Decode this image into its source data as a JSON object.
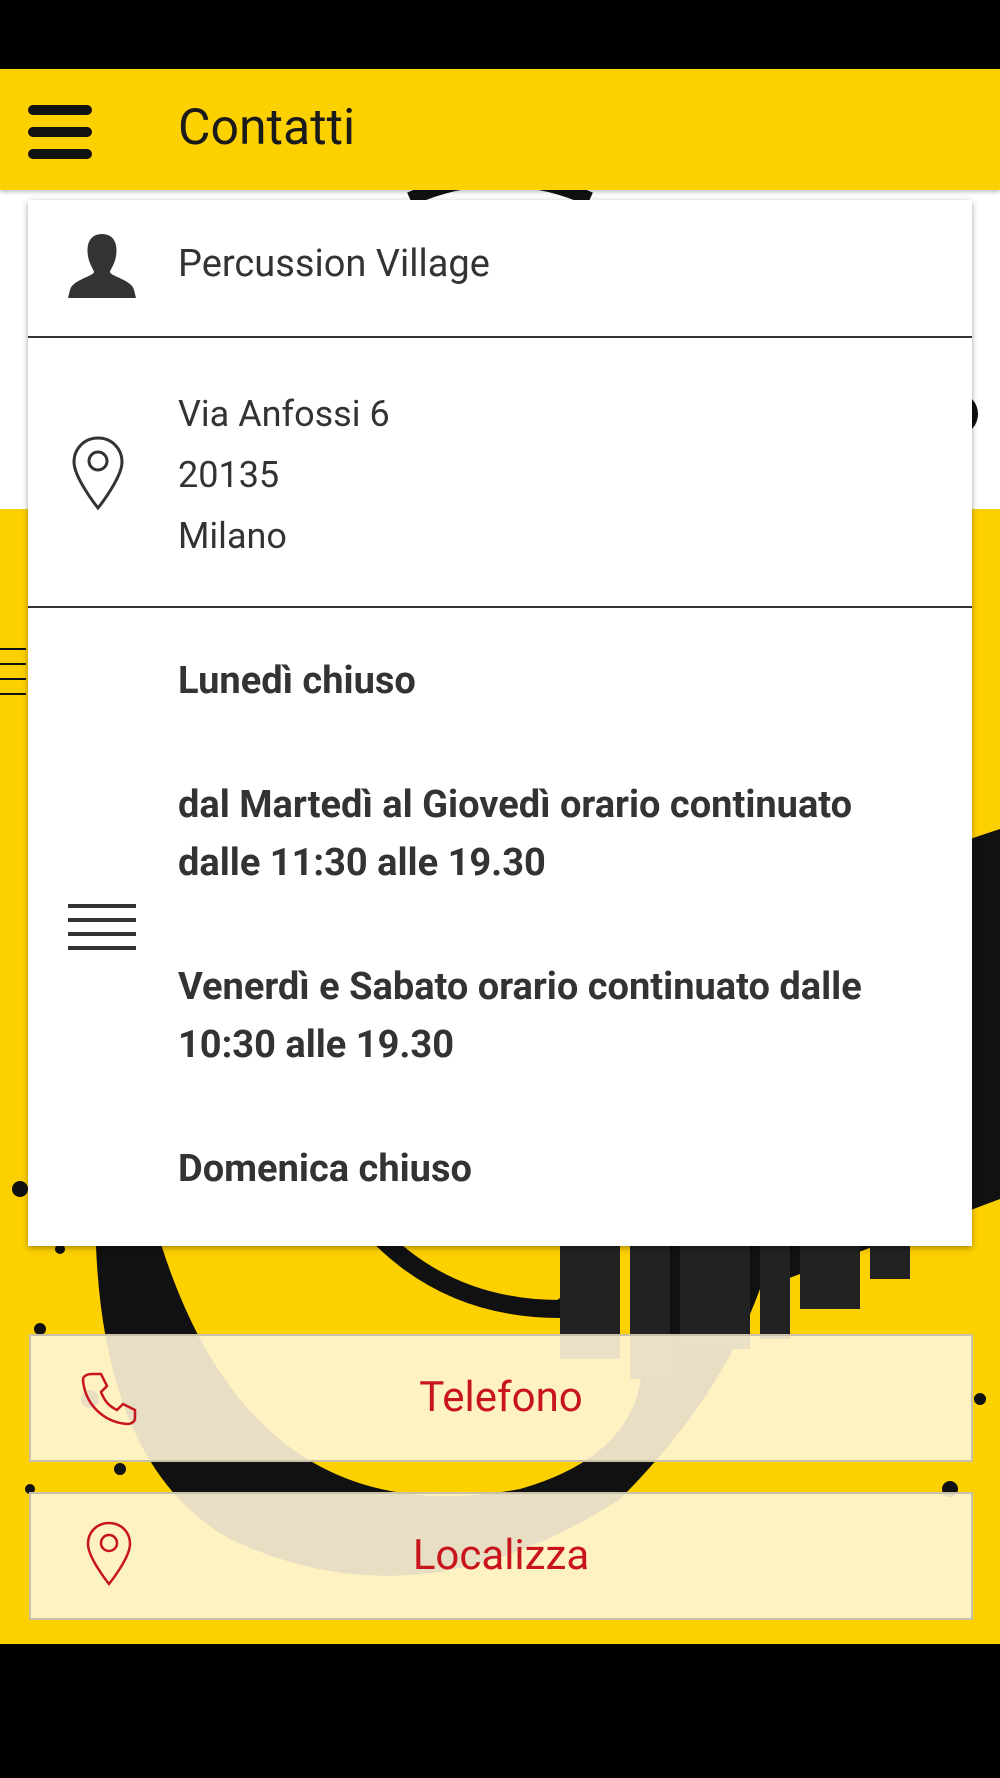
{
  "app_bar": {
    "title": "Contatti",
    "menu_icon": "hamburger-menu-icon"
  },
  "contact": {
    "name": "Percussion Village",
    "address": [
      "Via Anfossi 6",
      "20135",
      "Milano"
    ],
    "hours": [
      "Lunedì chiuso",
      "dal Martedì al Giovedì orario continuato dalle 11:30 alle 19.30",
      "Venerdì e Sabato orario continuato dalle 10:30 alle 19.30",
      "Domenica chiuso"
    ]
  },
  "actions": {
    "phone_label": "Telefono",
    "locate_label": "Localizza"
  },
  "colors": {
    "accent": "#fdd000",
    "action_text": "#c8141c",
    "text": "#333333"
  }
}
